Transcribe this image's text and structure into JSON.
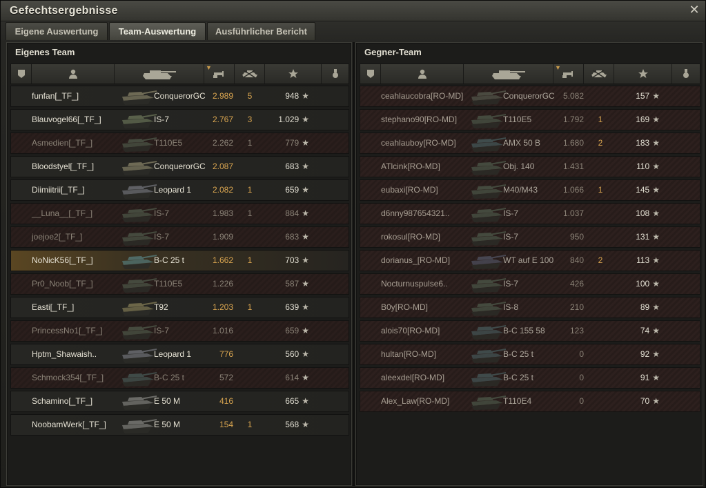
{
  "window": {
    "title": "Gefechtsergebnisse",
    "close_icon": "close-icon"
  },
  "tabs": [
    {
      "label": "Eigene Auswertung",
      "active": false
    },
    {
      "label": "Team-Auswertung",
      "active": true
    },
    {
      "label": "Ausführlicher Bericht",
      "active": false
    }
  ],
  "columns": [
    "rank-icon",
    "player-icon",
    "tank-icon",
    "damage-icon",
    "kills-icon",
    "xp-star-icon",
    "medal-icon"
  ],
  "colors": {
    "accent": "#d9a550",
    "highlight_row": "#5a4622",
    "dead_row": "#2a1e1c"
  },
  "own_team": {
    "title": "Eigenes Team",
    "players": [
      {
        "name": "funfan[_TF_]",
        "tank": "ConquerorGC",
        "damage": "2.989",
        "kills": "5",
        "xp": "948",
        "state": "alive",
        "tank_color": "#6e6a55"
      },
      {
        "name": "Blauvogel66[_TF_]",
        "tank": "IS-7",
        "damage": "2.767",
        "kills": "3",
        "xp": "1.029",
        "state": "alive",
        "tank_color": "#59604a"
      },
      {
        "name": "Asmedien[_TF_]",
        "tank": "T110E5",
        "damage": "2.262",
        "kills": "1",
        "xp": "779",
        "state": "dead",
        "tank_color": "#454a3e"
      },
      {
        "name": "Bloodstyel[_TF_]",
        "tank": "ConquerorGC",
        "damage": "2.087",
        "kills": "",
        "xp": "683",
        "state": "alive",
        "tank_color": "#6e6a55"
      },
      {
        "name": "Diimiitrii[_TF_]",
        "tank": "Leopard 1",
        "damage": "2.082",
        "kills": "1",
        "xp": "659",
        "state": "alive",
        "tank_color": "#5f6064"
      },
      {
        "name": "__Luna__[_TF_]",
        "tank": "IS-7",
        "damage": "1.983",
        "kills": "1",
        "xp": "884",
        "state": "dead",
        "tank_color": "#454a3e"
      },
      {
        "name": "joejoe2[_TF_]",
        "tank": "IS-7",
        "damage": "1.909",
        "kills": "",
        "xp": "683",
        "state": "dead",
        "tank_color": "#454a3e"
      },
      {
        "name": "NoNicK56[_TF_]",
        "tank": "B-C 25 t",
        "damage": "1.662",
        "kills": "1",
        "xp": "703",
        "state": "me",
        "tank_color": "#4f6a66"
      },
      {
        "name": "Pr0_Noob[_TF_]",
        "tank": "T110E5",
        "damage": "1.226",
        "kills": "",
        "xp": "587",
        "state": "dead",
        "tank_color": "#454a3e"
      },
      {
        "name": "Easti[_TF_]",
        "tank": "T92",
        "damage": "1.203",
        "kills": "1",
        "xp": "639",
        "state": "alive",
        "tank_color": "#6c6648"
      },
      {
        "name": "PrincessNo1[_TF_]",
        "tank": "IS-7",
        "damage": "1.016",
        "kills": "",
        "xp": "659",
        "state": "dead",
        "tank_color": "#454a3e"
      },
      {
        "name": "Hptm_Shawaish..",
        "tank": "Leopard 1",
        "damage": "776",
        "kills": "",
        "xp": "560",
        "state": "alive",
        "tank_color": "#5f6064"
      },
      {
        "name": "Schmock354[_TF_]",
        "tank": "B-C 25 t",
        "damage": "572",
        "kills": "",
        "xp": "614",
        "state": "dead",
        "tank_color": "#3f4a47"
      },
      {
        "name": "Schamino[_TF_]",
        "tank": "E 50 M",
        "damage": "416",
        "kills": "",
        "xp": "665",
        "state": "alive",
        "tank_color": "#6a6a66"
      },
      {
        "name": "NoobamWerk[_TF_]",
        "tank": "E 50 M",
        "damage": "154",
        "kills": "1",
        "xp": "568",
        "state": "alive",
        "tank_color": "#6a6a66"
      }
    ]
  },
  "enemy_team": {
    "title": "Gegner-Team",
    "players": [
      {
        "name": "ceahlaucobra[RO-MD]",
        "tank": "ConquerorGC",
        "damage": "5.082",
        "kills": "",
        "xp": "157",
        "tank_color": "#4a4a40"
      },
      {
        "name": "stephano90[RO-MD]",
        "tank": "T110E5",
        "damage": "1.792",
        "kills": "1",
        "xp": "169",
        "tank_color": "#444a3e"
      },
      {
        "name": "ceahlauboy[RO-MD]",
        "tank": "AMX 50 B",
        "damage": "1.680",
        "kills": "2",
        "xp": "183",
        "tank_color": "#3f4c4c"
      },
      {
        "name": "ATlcink[RO-MD]",
        "tank": "Obj. 140",
        "damage": "1.431",
        "kills": "",
        "xp": "110",
        "tank_color": "#444a3e"
      },
      {
        "name": "eubaxi[RO-MD]",
        "tank": "M40/M43",
        "damage": "1.066",
        "kills": "1",
        "xp": "145",
        "tank_color": "#444a3e"
      },
      {
        "name": "d6nny987654321..",
        "tank": "IS-7",
        "damage": "1.037",
        "kills": "",
        "xp": "108",
        "tank_color": "#444a3e"
      },
      {
        "name": "rokosul[RO-MD]",
        "tank": "IS-7",
        "damage": "950",
        "kills": "",
        "xp": "131",
        "tank_color": "#444a3e"
      },
      {
        "name": "dorianus_[RO-MD]",
        "tank": "WT auf E 100",
        "damage": "840",
        "kills": "2",
        "xp": "113",
        "tank_color": "#474651"
      },
      {
        "name": "Nocturnuspulse6..",
        "tank": "IS-7",
        "damage": "426",
        "kills": "",
        "xp": "100",
        "tank_color": "#444a3e"
      },
      {
        "name": "B0y[RO-MD]",
        "tank": "IS-8",
        "damage": "210",
        "kills": "",
        "xp": "89",
        "tank_color": "#444a3e"
      },
      {
        "name": "alois70[RO-MD]",
        "tank": "B-C 155 58",
        "damage": "123",
        "kills": "",
        "xp": "74",
        "tank_color": "#3f4a4a"
      },
      {
        "name": "hultan[RO-MD]",
        "tank": "B-C 25 t",
        "damage": "0",
        "kills": "",
        "xp": "92",
        "tank_color": "#3f4a4a"
      },
      {
        "name": "aleexdel[RO-MD]",
        "tank": "B-C 25 t",
        "damage": "0",
        "kills": "",
        "xp": "91",
        "tank_color": "#3f4a4a"
      },
      {
        "name": "Alex_Law[RO-MD]",
        "tank": "T110E4",
        "damage": "0",
        "kills": "",
        "xp": "70",
        "tank_color": "#444a3e"
      }
    ]
  }
}
